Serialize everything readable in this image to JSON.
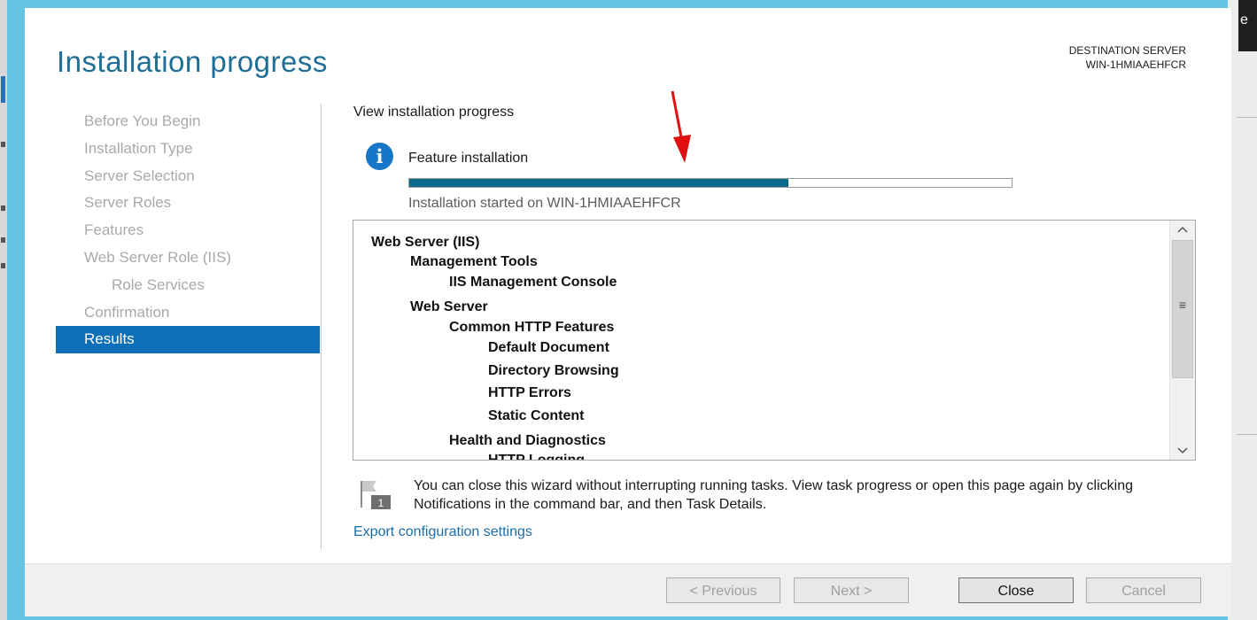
{
  "window": {
    "title": "Installation progress",
    "destination_label": "DESTINATION SERVER",
    "destination_server": "WIN-1HMIAAEHFCR",
    "background_title_glyph": "e"
  },
  "nav": {
    "items": [
      {
        "label": "Before You Begin",
        "state": "disabled"
      },
      {
        "label": "Installation Type",
        "state": "disabled"
      },
      {
        "label": "Server Selection",
        "state": "disabled"
      },
      {
        "label": "Server Roles",
        "state": "disabled"
      },
      {
        "label": "Features",
        "state": "disabled"
      },
      {
        "label": "Web Server Role (IIS)",
        "state": "disabled"
      },
      {
        "label": "Role Services",
        "state": "disabled",
        "indent": 1
      },
      {
        "label": "Confirmation",
        "state": "disabled"
      },
      {
        "label": "Results",
        "state": "active"
      }
    ]
  },
  "content": {
    "heading": "View installation progress",
    "feature_label": "Feature installation",
    "progress": 0.63,
    "started_text": "Installation started on WIN-1HMIAAEHFCR",
    "features": [
      {
        "label": "Web Server (IIS)",
        "level": 0
      },
      {
        "label": "Management Tools",
        "level": 1
      },
      {
        "label": "IIS Management Console",
        "level": 2
      },
      {
        "label": "Web Server",
        "level": 1
      },
      {
        "label": "Common HTTP Features",
        "level": 2
      },
      {
        "label": "Default Document",
        "level": 3
      },
      {
        "label": "Directory Browsing",
        "level": 3
      },
      {
        "label": "HTTP Errors",
        "level": 3
      },
      {
        "label": "Static Content",
        "level": 3
      },
      {
        "label": "Health and Diagnostics",
        "level": 2
      },
      {
        "label": "HTTP Logging",
        "level": 3
      }
    ],
    "note": "You can close this wizard without interrupting running tasks. View task progress or open this page again by clicking Notifications in the command bar, and then Task Details.",
    "notification_count": "1",
    "export_link": "Export configuration settings"
  },
  "footer": {
    "previous": "< Previous",
    "next": "Next >",
    "close": "Close",
    "cancel": "Cancel"
  },
  "colors": {
    "frame": "#66c2e2",
    "title": "#1f6e96",
    "nav_active": "#0d6fb8",
    "progress_fill": "#0b6a8a",
    "link": "#1b6fa8",
    "annotation_arrow": "#e01010"
  },
  "icons": {
    "info": "info-icon",
    "notification": "flag-icon",
    "scroll_up": "chevron-up-icon",
    "scroll_down": "chevron-down-icon",
    "scroll_grip": "grip-icon",
    "annotation": "arrow-down-icon"
  }
}
